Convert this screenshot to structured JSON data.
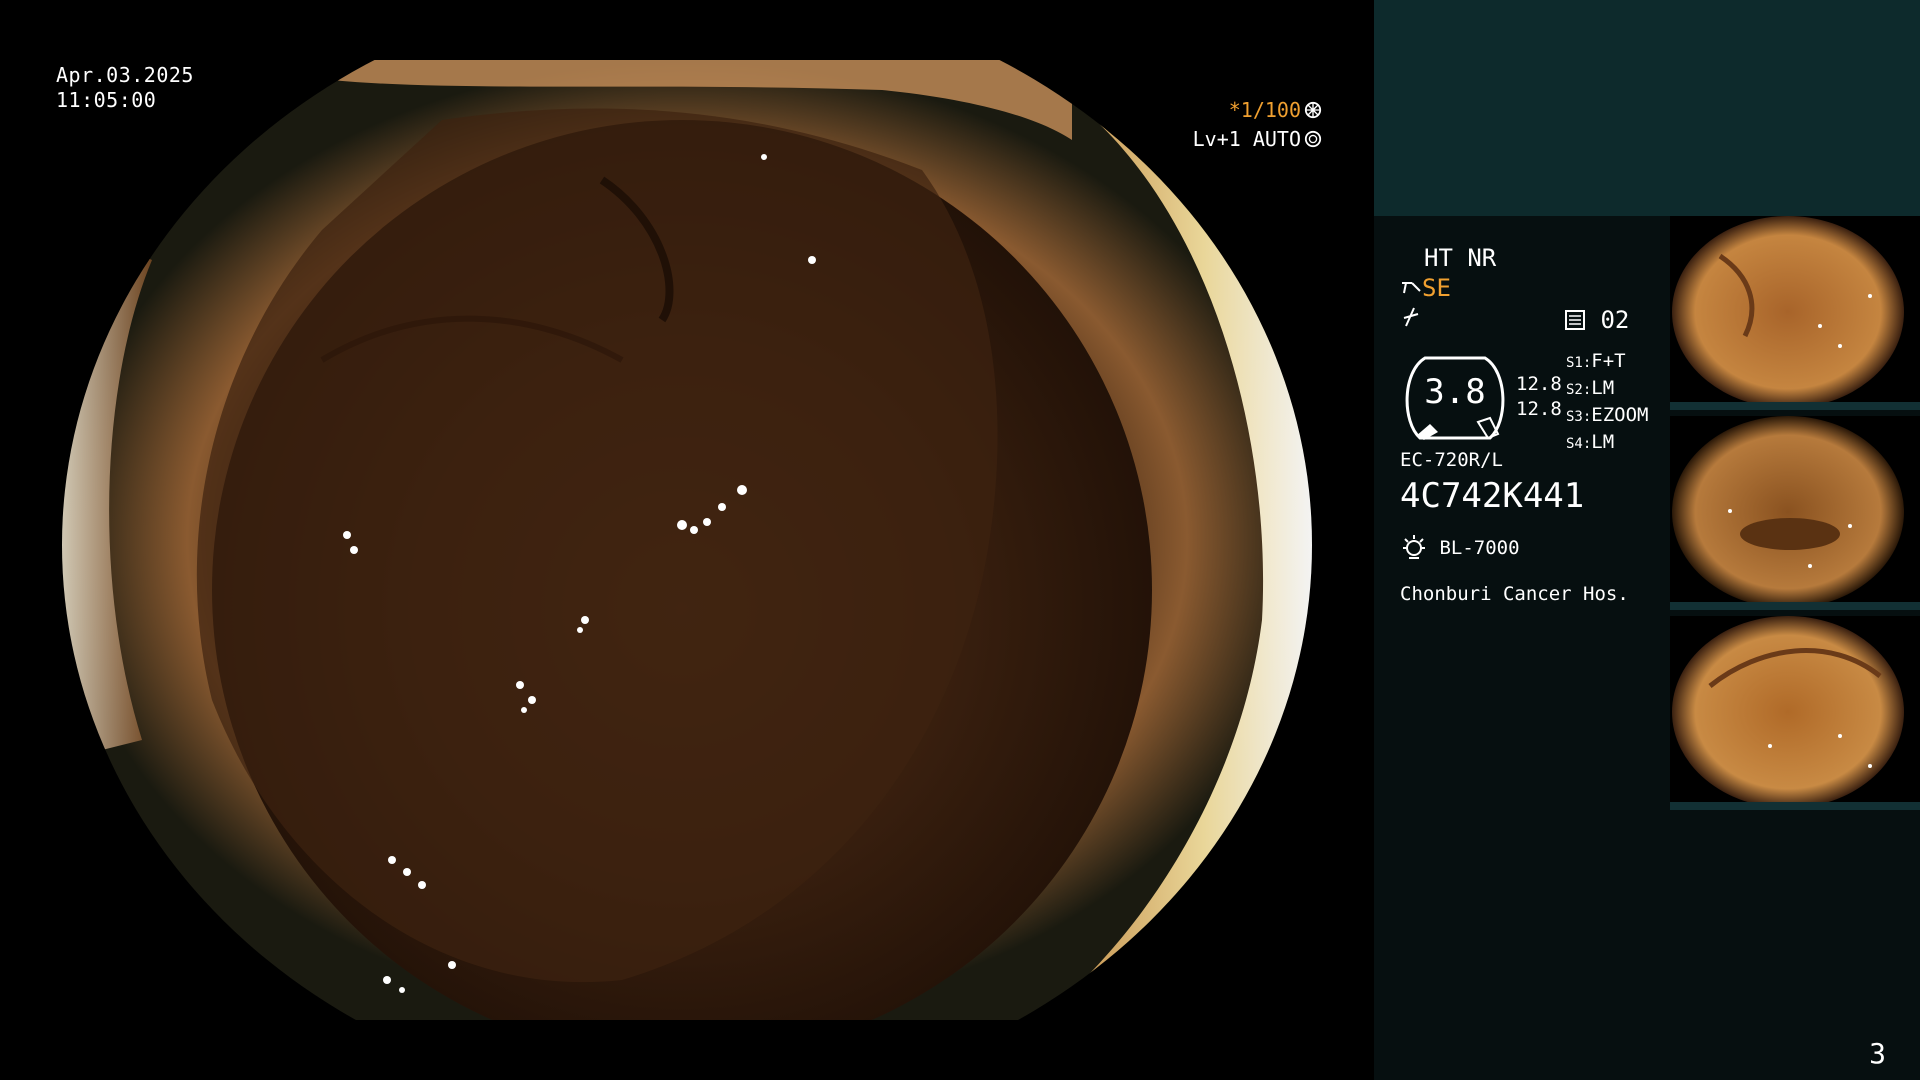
{
  "header": {
    "date": "Apr.03.2025",
    "time": "11:05:00"
  },
  "overlay": {
    "shutter": "*1/100",
    "iris_level": "Lv+1 AUTO"
  },
  "panel": {
    "mode_line1": "HT NR",
    "mode_se": "SE",
    "memory_slot": "02",
    "gauge_value": "3.8",
    "gauge_side_top": "12.8",
    "gauge_side_bottom": "12.8",
    "scope_buttons": [
      {
        "key": "S1:",
        "value": "F+T"
      },
      {
        "key": "S2:",
        "value": "LM"
      },
      {
        "key": "S3:",
        "value": "EZOOM"
      },
      {
        "key": "S4:",
        "value": "LM"
      }
    ],
    "scope_model": "EC-720R/L",
    "scope_serial": "4C742K441",
    "light_source": "BL-7000",
    "hospital": "Chonburi Cancer Hos."
  },
  "thumbnails": [
    {
      "label": "Thumbnail 1"
    },
    {
      "label": "Thumbnail 2"
    },
    {
      "label": "Thumbnail 3"
    }
  ],
  "page_number": "3",
  "colors": {
    "accent_orange": "#f0a030",
    "panel_bg": "#060f10",
    "panel_top_bg": "#0d2a2c"
  }
}
